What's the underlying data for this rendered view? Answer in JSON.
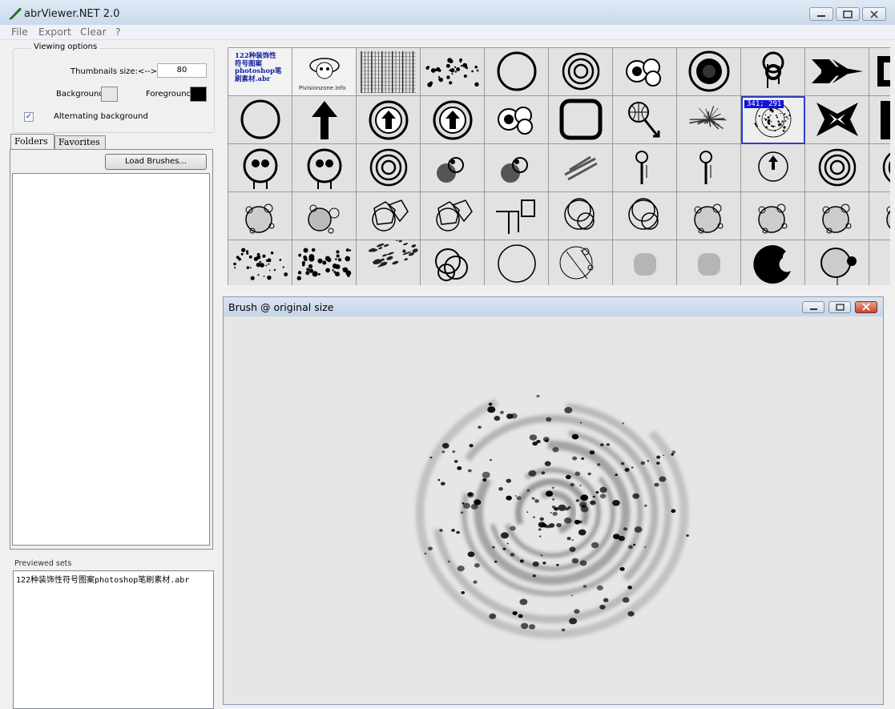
{
  "window": {
    "title": "abrViewer.NET 2.0"
  },
  "menu": [
    "File",
    "Export",
    "Clear",
    "?"
  ],
  "viewing_options": {
    "legend": "Viewing options",
    "thumb_size_label": "Thumbnails size:",
    "thumb_arrow": "<-->",
    "thumb_size_value": "80",
    "background_label": "Background:",
    "background_color": "#e6e6e6",
    "foreground_label": "Foreground:",
    "foreground_color": "#000000",
    "alternating_label": "Alternating background",
    "alternating_checked": true
  },
  "tabs": {
    "folders": "Folders",
    "favorites": "Favorites"
  },
  "load_button": "Load Brushes...",
  "previewed": {
    "label": "Previewed sets",
    "items": [
      "122种装饰性符号图案photoshop笔刷素材.abr"
    ]
  },
  "grid": {
    "first_cell_text": [
      "122种装饰性",
      "符号图案",
      "photoshop笔",
      "刷素材.abr"
    ],
    "second_cell_text": "Pivisionzone.info",
    "selected_label": "341; 291"
  },
  "brush_window": {
    "title": "Brush @ original size"
  }
}
